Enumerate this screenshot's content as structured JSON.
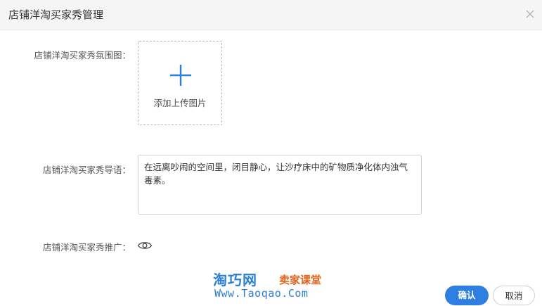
{
  "dialog": {
    "title": "店铺洋淘买家秀管理"
  },
  "form": {
    "atmosphere_label": "店铺洋淘买家秀氛围图：",
    "upload_text": "添加上传图片",
    "guide_label": "店铺洋淘买家秀导语：",
    "guide_value": "在远离吵闹的空间里，闭目静心，让沙疗床中的矿物质净化体内浊气毒素。",
    "promote_label": "店铺洋淘买家秀推广："
  },
  "watermark": {
    "brand": "淘巧网",
    "sub": "卖家课堂",
    "url": "Www.Taoqao.Com"
  },
  "buttons": {
    "confirm": "确认",
    "cancel": "取消"
  },
  "colors": {
    "primary": "#2f7fe0",
    "plus_icon": "#2b7fd6",
    "watermark_blue": "#2b7fd6",
    "watermark_orange": "#e2611b"
  },
  "icons": {
    "close": "close-icon",
    "plus": "plus-icon",
    "eye": "eye-icon"
  }
}
